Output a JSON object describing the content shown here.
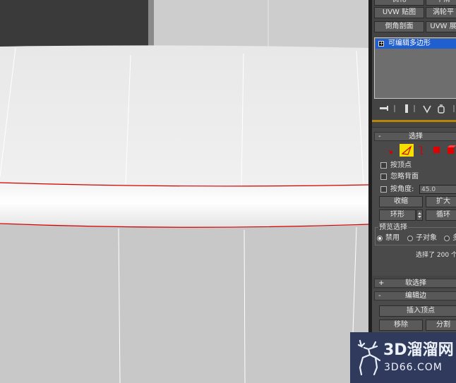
{
  "panel": {
    "top_buttons": [
      "优化",
      "平滑",
      "UVW 贴图",
      "涡轮平",
      "倒角剖面",
      "UVW 展"
    ],
    "modifier_stack": {
      "selected_item": "可编辑多边形"
    },
    "stack_tools": [
      "pin-stack-icon",
      "show-end-result-icon",
      "make-unique-icon",
      "remove-modifier-icon",
      "configure-sets-icon"
    ],
    "selection_rollout": {
      "title": "选择",
      "sign": "-",
      "subobject_icons": [
        "vertex-icon",
        "edge-icon",
        "border-icon",
        "polygon-icon",
        "element-icon"
      ],
      "active_subobject": "edge-icon",
      "by_vertex": "按顶点",
      "ignore_backfacing": "忽略背面",
      "by_angle": "按角度:",
      "angle_value": "45.0",
      "shrink": "收缩",
      "grow": "扩大",
      "ring": "环形",
      "loop": "循环",
      "preview_label": "预览选择",
      "preview_options": [
        "禁用",
        "子对象",
        "多"
      ],
      "preview_selected": "禁用",
      "status": "选择了 200 个"
    },
    "soft_selection_rollout": {
      "title": "软选择",
      "sign": "+"
    },
    "edit_edges_rollout": {
      "title": "编辑边",
      "sign": "-",
      "insert_vertex": "插入顶点",
      "remove": "移除",
      "split": "分割"
    }
  },
  "watermark": {
    "logo_text": "3D溜溜网",
    "url_text": "3D66.COM"
  },
  "colors": {
    "selection_highlight": "#1f5fcf",
    "active_tool": "#f5e000",
    "selected_edge": "#d40000",
    "viewport_bg": "#c7c7c7"
  }
}
